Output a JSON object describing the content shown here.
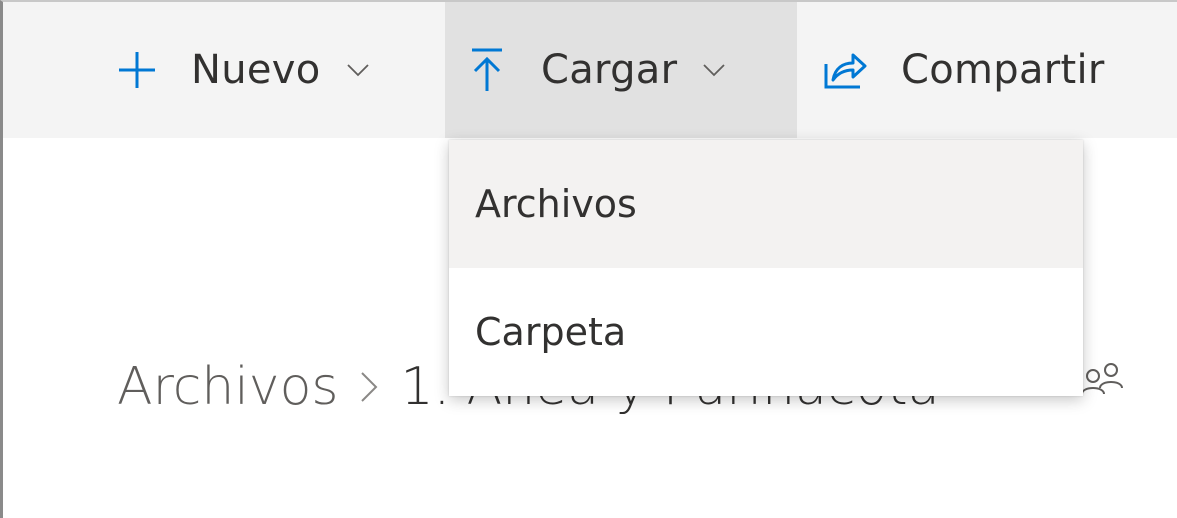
{
  "toolbar": {
    "new": {
      "label": "Nuevo",
      "icon": "plus-icon"
    },
    "upload": {
      "label": "Cargar",
      "icon": "upload-icon"
    },
    "share": {
      "label": "Compartir",
      "icon": "share-icon"
    }
  },
  "upload_menu": {
    "items": [
      {
        "label": "Archivos"
      },
      {
        "label": "Carpeta"
      }
    ]
  },
  "breadcrumb": {
    "root": "Archivos",
    "current": "1. Añea y Purinacota"
  },
  "colors": {
    "accent": "#0078d4",
    "toolbar_bg": "#f4f4f4",
    "active_command_bg": "#e1e1e1",
    "text": "#323130",
    "muted_text": "#605e5c",
    "menu_hover_bg": "#f3f2f1"
  }
}
